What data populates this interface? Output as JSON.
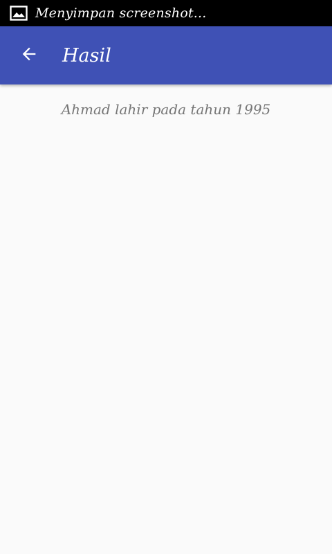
{
  "status_bar": {
    "icon": "image-icon",
    "text": "Menyimpan screenshot..."
  },
  "app_bar": {
    "back_icon": "arrow-back-icon",
    "title": "Hasil",
    "color": "#3f51b5"
  },
  "content": {
    "result_text": "Ahmad lahir pada tahun 1995"
  }
}
